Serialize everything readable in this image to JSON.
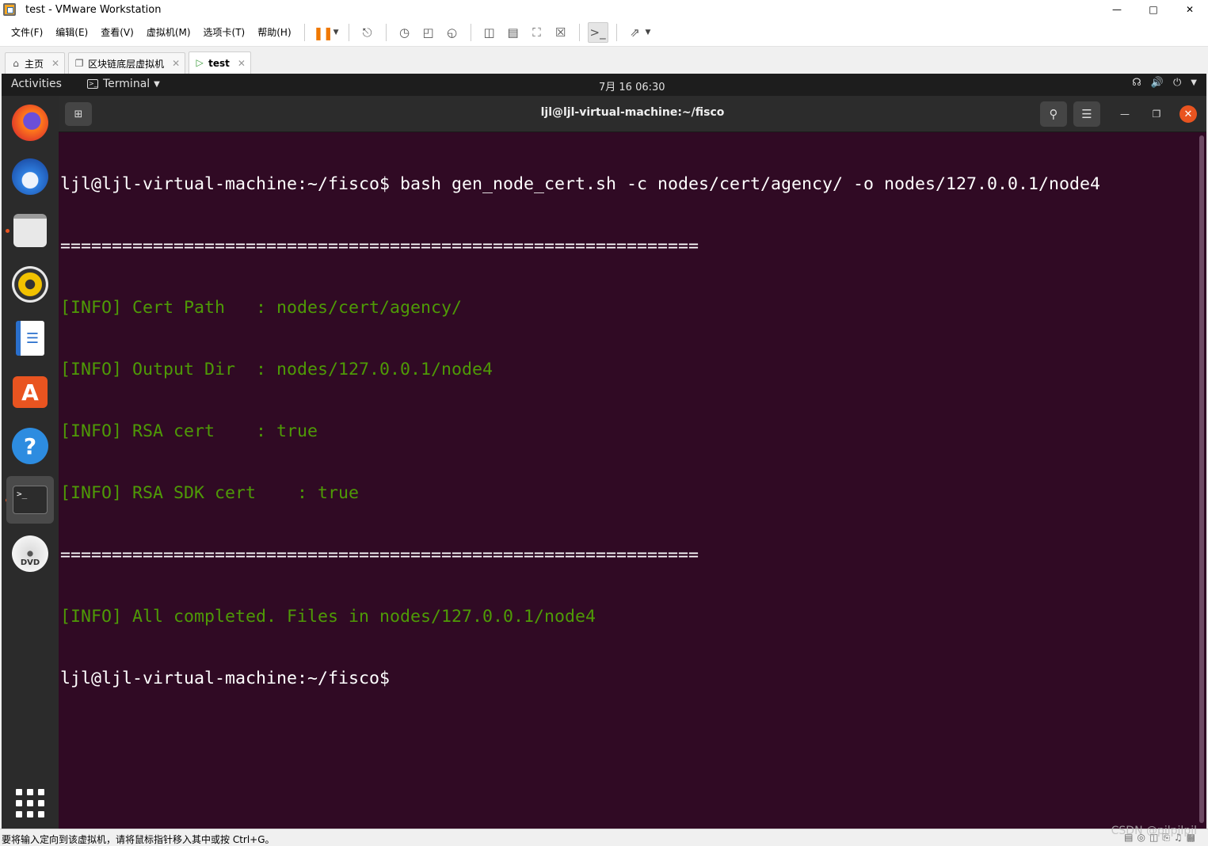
{
  "window": {
    "title": "test - VMware Workstation"
  },
  "menu": [
    "文件(F)",
    "编辑(E)",
    "查看(V)",
    "虚拟机(M)",
    "选项卡(T)",
    "帮助(H)"
  ],
  "tabs": [
    {
      "label": "主页",
      "icon": "home-icon"
    },
    {
      "label": "区块链底层虚拟机",
      "icon": "vm-icon"
    },
    {
      "label": "test",
      "icon": "vm-running-icon"
    }
  ],
  "gnome": {
    "activities": "Activities",
    "app_menu": "Terminal",
    "clock": "7月 16  06:30"
  },
  "terminal": {
    "title": "ljl@ljl-virtual-machine:~/fisco",
    "lines": [
      "ljl@ljl-virtual-machine:~/fisco$ bash gen_node_cert.sh -c nodes/cert/agency/ -o nodes/127.0.0.1/node4",
      "==============================================================",
      "[INFO] Cert Path   : nodes/cert/agency/",
      "[INFO] Output Dir  : nodes/127.0.0.1/node4",
      "[INFO] RSA cert    : true",
      "[INFO] RSA SDK cert    : true",
      "==============================================================",
      "[INFO] All completed. Files in nodes/127.0.0.1/node4",
      "ljl@ljl-virtual-machine:~/fisco$"
    ]
  },
  "statusbar": {
    "message": "要将输入定向到该虚拟机，请将鼠标指针移入其中或按 Ctrl+G。",
    "watermark": "CSDN @pjlpjlpjl"
  },
  "colors": {
    "terminal_bg": "#300a24",
    "info_green": "#4e9a06",
    "ubuntu_orange": "#e95420"
  }
}
